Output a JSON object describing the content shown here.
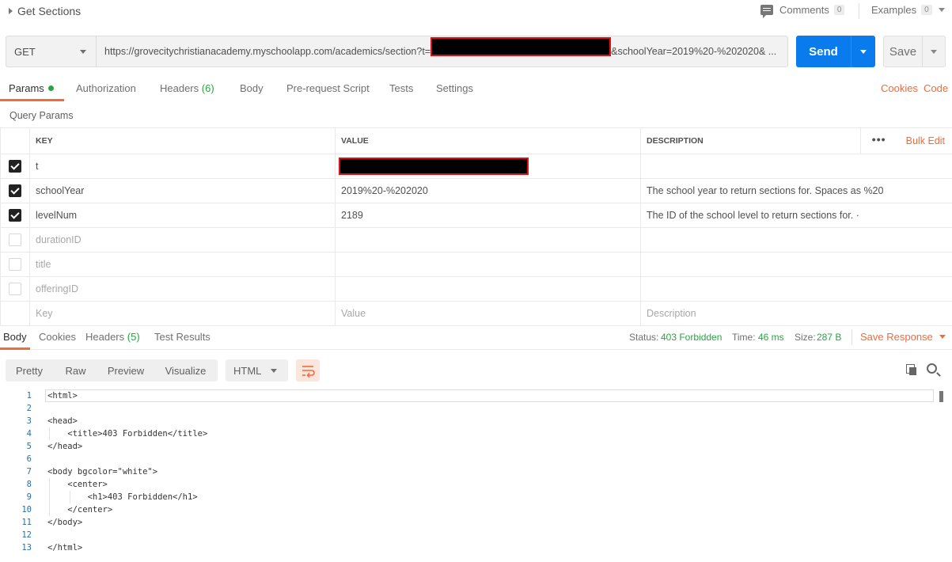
{
  "request": {
    "name": "Get Sections",
    "comments_label": "Comments",
    "comments_count": "0",
    "examples_label": "Examples",
    "examples_count": "0",
    "method": "GET",
    "url_prefix": "https://grovecitychristianacademy.myschoolapp.com/academics/section?t=",
    "url_suffix": "&schoolYear=2019%20-%202020& ...",
    "send_label": "Send",
    "save_label": "Save"
  },
  "request_tabs": {
    "params": "Params",
    "authorization": "Authorization",
    "headers": "Headers",
    "headers_count": "(6)",
    "body": "Body",
    "prerequest": "Pre-request Script",
    "tests": "Tests",
    "settings": "Settings",
    "cookies": "Cookies",
    "code": "Code"
  },
  "query_params": {
    "section_label": "Query Params",
    "columns": {
      "key": "KEY",
      "value": "VALUE",
      "description": "DESCRIPTION"
    },
    "more_label": "•••",
    "bulk_edit": "Bulk Edit",
    "rows": [
      {
        "checked": true,
        "key": "t",
        "value": "",
        "description": ""
      },
      {
        "checked": true,
        "key": "schoolYear",
        "value": "2019%20-%202020",
        "description": "The school year to return sections for. Spaces as %20"
      },
      {
        "checked": true,
        "key": "levelNum",
        "value": "2189",
        "description": "The ID of the school level to return sections for. ·"
      },
      {
        "checked": false,
        "key": "durationID",
        "value": "",
        "description": ""
      },
      {
        "checked": false,
        "key": "title",
        "value": "",
        "description": ""
      },
      {
        "checked": false,
        "key": "offeringID",
        "value": "",
        "description": ""
      }
    ],
    "placeholder": {
      "key": "Key",
      "value": "Value",
      "description": "Description"
    }
  },
  "response_tabs": {
    "body": "Body",
    "cookies": "Cookies",
    "headers": "Headers",
    "headers_count": "(5)",
    "test_results": "Test Results",
    "status_label": "Status:",
    "status_value": "403 Forbidden",
    "time_label": "Time:",
    "time_value": "46 ms",
    "size_label": "Size:",
    "size_value": "287 B",
    "save_response": "Save Response"
  },
  "view": {
    "pretty": "Pretty",
    "raw": "Raw",
    "preview": "Preview",
    "visualize": "Visualize",
    "format": "HTML"
  },
  "code_lines": [
    {
      "n": "1",
      "text": "<html>"
    },
    {
      "n": "2",
      "text": ""
    },
    {
      "n": "3",
      "text": "<head>"
    },
    {
      "n": "4",
      "text": "    <title>403 Forbidden</title>"
    },
    {
      "n": "5",
      "text": "</head>"
    },
    {
      "n": "6",
      "text": ""
    },
    {
      "n": "7",
      "text": "<body bgcolor=\"white\">"
    },
    {
      "n": "8",
      "text": "    <center>"
    },
    {
      "n": "9",
      "text": "        <h1>403 Forbidden</h1>"
    },
    {
      "n": "10",
      "text": "    </center>"
    },
    {
      "n": "11",
      "text": "</body>"
    },
    {
      "n": "12",
      "text": ""
    },
    {
      "n": "13",
      "text": "</html>"
    }
  ],
  "colors": {
    "accent_orange": "#f26b3a",
    "send_blue": "#097bed",
    "status_green": "#26a641"
  }
}
